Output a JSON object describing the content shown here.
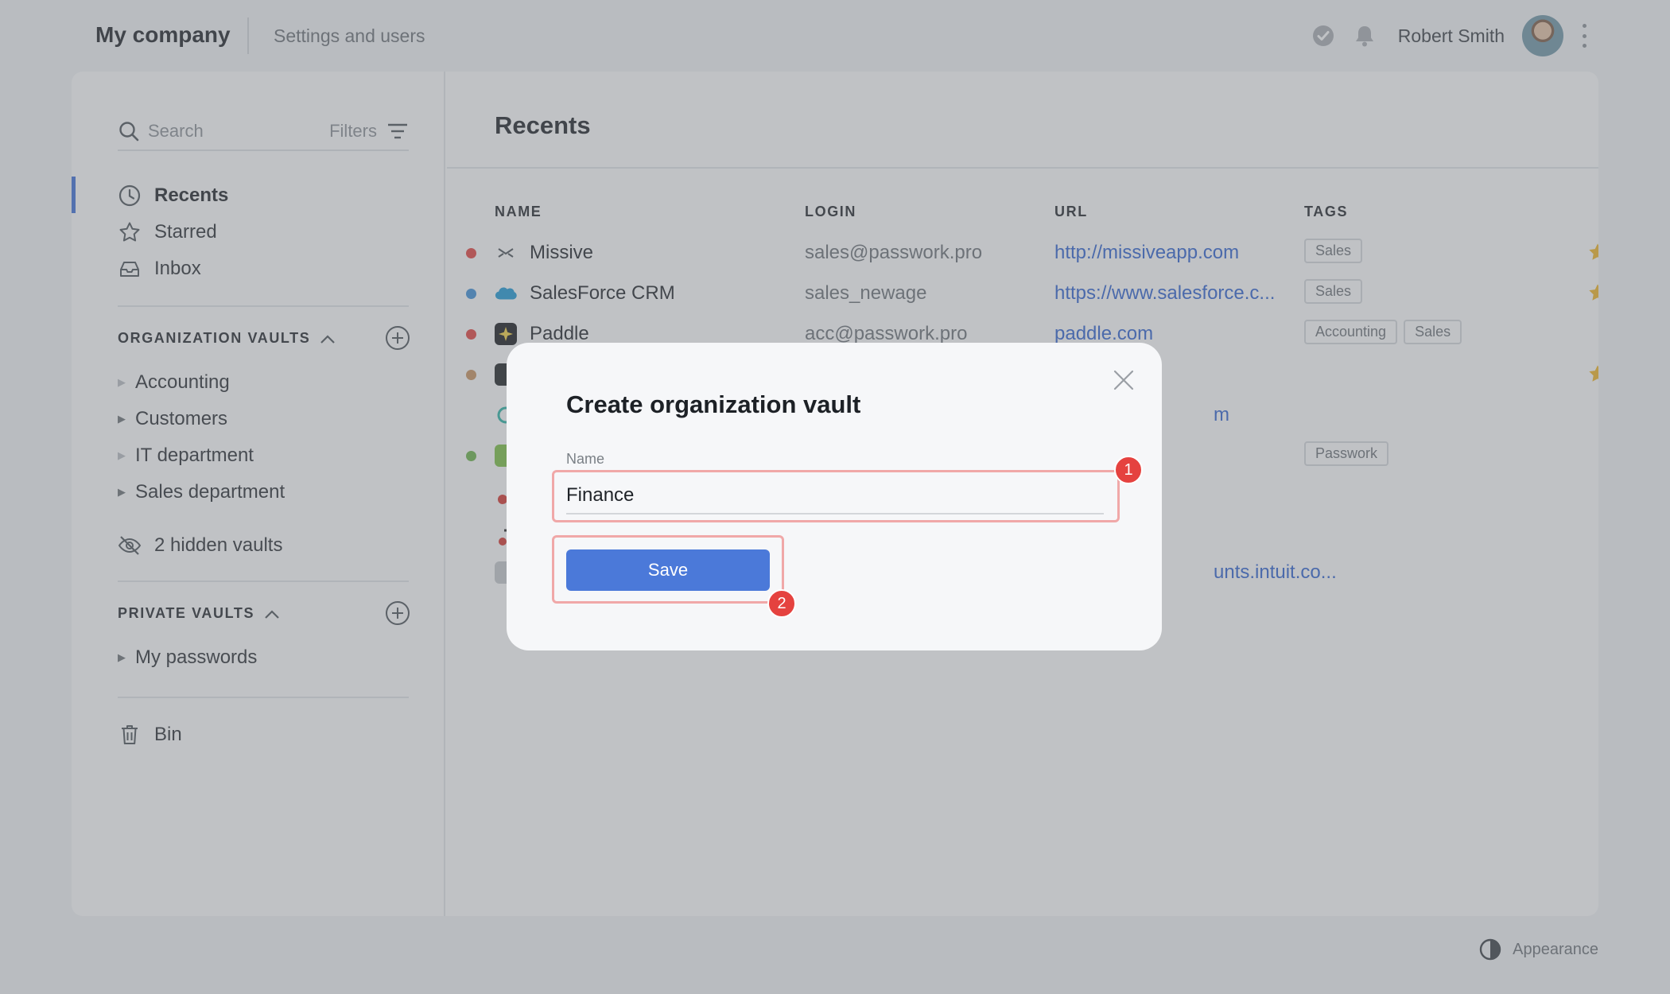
{
  "header": {
    "company": "My company",
    "settings_link": "Settings and users",
    "user_name": "Robert Smith"
  },
  "sidebar": {
    "search_placeholder": "Search",
    "filters_label": "Filters",
    "nav": [
      {
        "label": "Recents",
        "icon": "clock-icon",
        "active": true
      },
      {
        "label": "Starred",
        "icon": "star-outline-icon"
      },
      {
        "label": "Inbox",
        "icon": "inbox-icon"
      }
    ],
    "org_section": "ORGANIZATION VAULTS",
    "org_vaults": [
      "Accounting",
      "Customers",
      "IT department",
      "Sales department"
    ],
    "hidden_vaults": "2 hidden vaults",
    "private_section": "PRIVATE VAULTS",
    "private_vaults": [
      "My passwords"
    ],
    "bin": "Bin"
  },
  "content": {
    "title": "Recents",
    "columns": {
      "name": "NAME",
      "login": "LOGIN",
      "url": "URL",
      "tags": "TAGS"
    },
    "rows": [
      {
        "name": "Missive",
        "login": "sales@passwork.pro",
        "url": "http://missiveapp.com",
        "tags": [
          "Sales"
        ],
        "starred": true,
        "dot_color": "#e5423f"
      },
      {
        "name": "SalesForce CRM",
        "login": "sales_newage",
        "url": "https://www.salesforce.c...",
        "tags": [
          "Sales"
        ],
        "starred": true,
        "dot_color": "#3d8fd8"
      },
      {
        "name": "Paddle",
        "login": "acc@passwork.pro",
        "url": "paddle.com",
        "tags": [
          "Accounting",
          "Sales"
        ],
        "starred": false,
        "dot_color": "#e5423f"
      },
      {
        "name": "",
        "login": "",
        "url": "",
        "tags": [],
        "starred": true,
        "dot_color": "#c9925f"
      },
      {
        "name": "",
        "login": "",
        "url": "m",
        "tags": [],
        "starred": false,
        "dot_color": ""
      },
      {
        "name": "",
        "login": "",
        "url": "",
        "tags": [
          "Passwork"
        ],
        "starred": false,
        "dot_color": "#6bb549"
      },
      {
        "name": "",
        "login": "",
        "url": "",
        "tags": [],
        "starred": false,
        "dot_color": ""
      },
      {
        "name": "",
        "login": "",
        "url": "",
        "tags": [],
        "starred": false,
        "dot_color": ""
      },
      {
        "name": "",
        "login": "",
        "url": "unts.intuit.co...",
        "tags": [],
        "starred": false,
        "dot_color": ""
      }
    ]
  },
  "modal": {
    "title": "Create organization vault",
    "name_label": "Name",
    "name_value": "Finance",
    "save_label": "Save",
    "marker_1": "1",
    "marker_2": "2"
  },
  "footer": {
    "appearance": "Appearance"
  },
  "colors": {
    "accent": "#4b79d9",
    "link": "#2f62d0",
    "marker": "#e5423f",
    "star": "#f2b624"
  }
}
